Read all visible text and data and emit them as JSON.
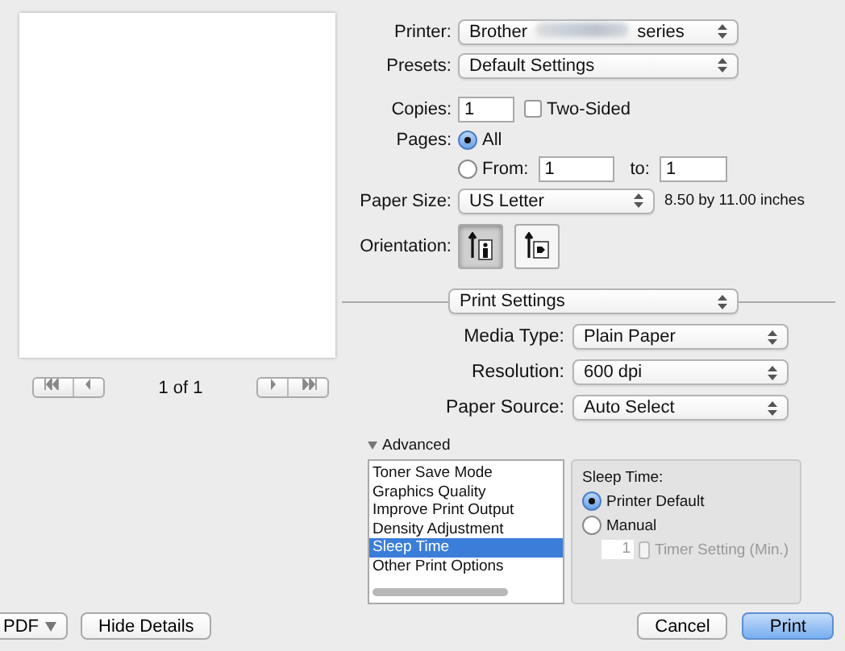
{
  "preview": {
    "page_label": "1 of 1"
  },
  "printer": {
    "label": "Printer:",
    "value_start": "Brother",
    "value_end": "series",
    "redacted": true
  },
  "presets": {
    "label": "Presets:",
    "value": "Default Settings"
  },
  "copies": {
    "label": "Copies:",
    "value": "1",
    "two_sided": {
      "label": "Two-Sided",
      "checked": false
    }
  },
  "pages": {
    "label": "Pages:",
    "options": [
      {
        "label": "All",
        "selected": true
      },
      {
        "label": "From:",
        "selected": false
      }
    ],
    "from": "1",
    "to_label": "to:",
    "to": "1"
  },
  "paper_size": {
    "label": "Paper Size:",
    "value": "US Letter",
    "dimensions": "8.50 by 11.00 inches"
  },
  "orientation": {
    "label": "Orientation:",
    "options": [
      {
        "kind": "portrait",
        "selected": true
      },
      {
        "kind": "landscape",
        "selected": false
      }
    ]
  },
  "section": {
    "value": "Print Settings"
  },
  "settings": [
    {
      "label": "Media Type:",
      "value": "Plain Paper"
    },
    {
      "label": "Resolution:",
      "value": "600 dpi"
    },
    {
      "label": "Paper Source:",
      "value": "Auto Select"
    }
  ],
  "advanced": {
    "label": "Advanced",
    "expanded": true,
    "items": [
      {
        "label": "Toner Save Mode",
        "selected": false
      },
      {
        "label": "Graphics Quality",
        "selected": false
      },
      {
        "label": "Improve Print Output",
        "selected": false
      },
      {
        "label": "Density Adjustment",
        "selected": false
      },
      {
        "label": "Sleep Time",
        "selected": true
      },
      {
        "label": "Other Print Options",
        "selected": false
      }
    ],
    "detail": {
      "title": "Sleep Time:",
      "options": [
        {
          "label": "Printer Default",
          "selected": true
        },
        {
          "label": "Manual",
          "selected": false
        }
      ],
      "timer_value": "1",
      "timer_label": "Timer Setting (Min.)",
      "timer_disabled": true
    }
  },
  "buttons": {
    "pdf": "PDF",
    "hide_details": "Hide Details",
    "cancel": "Cancel",
    "print": "Print"
  }
}
